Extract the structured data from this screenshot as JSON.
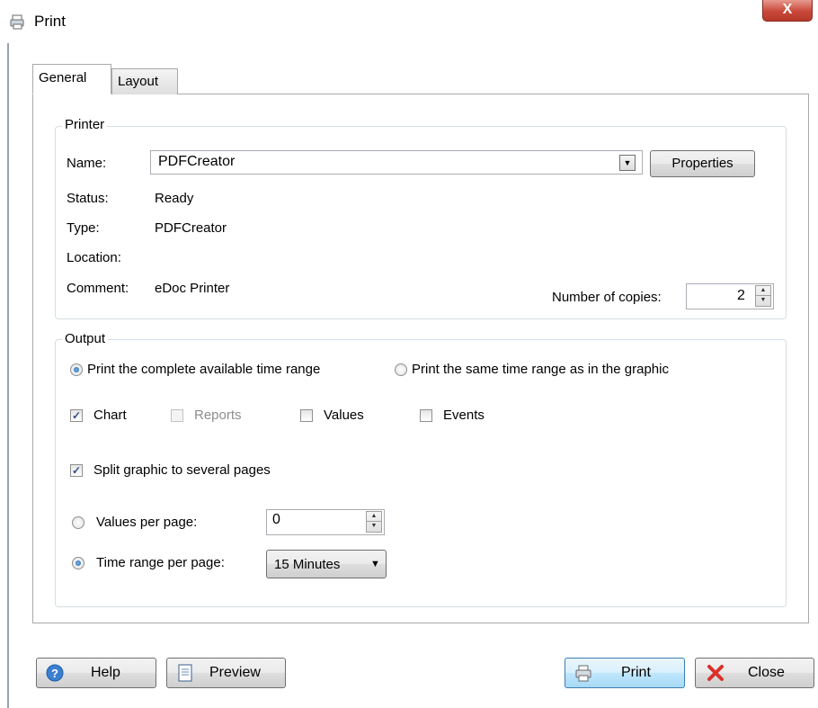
{
  "window": {
    "title": "Print",
    "close_glyph": "X"
  },
  "tabs": [
    {
      "label": "General",
      "selected": true
    },
    {
      "label": "Layout",
      "selected": false
    }
  ],
  "printer": {
    "legend": "Printer",
    "name_label": "Name:",
    "name_value": "PDFCreator",
    "properties_label": "Properties",
    "status_label": "Status:",
    "status_value": "Ready",
    "type_label": "Type:",
    "type_value": "PDFCreator",
    "location_label": "Location:",
    "location_value": "",
    "comment_label": "Comment:",
    "comment_value": "eDoc Printer",
    "copies_label": "Number of copies:",
    "copies_value": "2"
  },
  "output": {
    "legend": "Output",
    "range_complete_label": "Print the complete available time range",
    "range_complete_selected": true,
    "range_graphic_label": "Print the same time range as in the graphic",
    "range_graphic_selected": false,
    "chart_label": "Chart",
    "chart_checked": true,
    "reports_label": "Reports",
    "reports_checked": false,
    "reports_enabled": false,
    "values_label": "Values",
    "values_checked": false,
    "events_label": "Events",
    "events_checked": false,
    "split_label": "Split graphic to several pages",
    "split_checked": true,
    "values_per_page_label": "Values per page:",
    "values_per_page_value": "0",
    "values_per_page_selected": false,
    "time_range_per_page_label": "Time range per page:",
    "time_range_per_page_value": "15 Minutes",
    "time_range_per_page_selected": true
  },
  "buttons": {
    "help": "Help",
    "preview": "Preview",
    "print": "Print",
    "close": "Close"
  },
  "colors": {
    "accent": "#1c5fa8",
    "close_red": "#c9483a",
    "border": "#a9a9a9"
  }
}
